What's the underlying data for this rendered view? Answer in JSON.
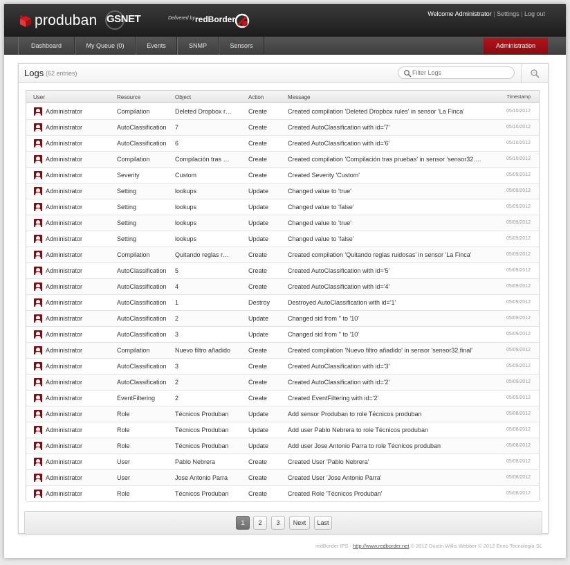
{
  "header": {
    "brand": "produban",
    "partner": "GSNET",
    "delivered_by": "Delivered by",
    "redborder": "redBorder",
    "welcome": "Welcome Administrator",
    "settings": "Settings",
    "logout": "Log out",
    "separator": "|"
  },
  "nav": {
    "items": [
      "Dashboard",
      "My Queue (0)",
      "Events",
      "SNMP",
      "Sensors"
    ],
    "admin": "Administration",
    "admin_color": "#a30f16"
  },
  "panel": {
    "title": "Logs",
    "count": "(62 entries)",
    "filter_placeholder": "Filter Logs"
  },
  "table": {
    "headers": {
      "user": "User",
      "resource": "Resource",
      "object": "Object",
      "action": "Action",
      "message": "Message",
      "timestamp": "Timestamp"
    },
    "rows": [
      {
        "user": "Administrator",
        "resource": "Compilation",
        "object": "Deleted Dropbox r…",
        "action": "Create",
        "message": "Created compilation 'Deleted Dropbox rules' in sensor 'La Finca'",
        "timestamp": "05/10/2012"
      },
      {
        "user": "Administrator",
        "resource": "AutoClassification",
        "object": "7",
        "action": "Create",
        "message": "Created AutoClassification with id='7'",
        "timestamp": "05/10/2012"
      },
      {
        "user": "Administrator",
        "resource": "AutoClassification",
        "object": "6",
        "action": "Create",
        "message": "Created AutoClassification with id='6'",
        "timestamp": "05/10/2012"
      },
      {
        "user": "Administrator",
        "resource": "Compilation",
        "object": "Compilación tras …",
        "action": "Create",
        "message": "Created compilation 'Compilación tras pruebas' in sensor 'sensor32.…",
        "timestamp": "05/10/2012"
      },
      {
        "user": "Administrator",
        "resource": "Severity",
        "object": "Custom",
        "action": "Create",
        "message": "Created Severity 'Custom'",
        "timestamp": "05/09/2012"
      },
      {
        "user": "Administrator",
        "resource": "Setting",
        "object": "lookups",
        "action": "Update",
        "message": "Changed value to 'true'",
        "timestamp": "05/09/2012"
      },
      {
        "user": "Administrator",
        "resource": "Setting",
        "object": "lookups",
        "action": "Update",
        "message": "Changed value to 'false'",
        "timestamp": "05/09/2012"
      },
      {
        "user": "Administrator",
        "resource": "Setting",
        "object": "lookups",
        "action": "Update",
        "message": "Changed value to 'true'",
        "timestamp": "05/09/2012"
      },
      {
        "user": "Administrator",
        "resource": "Setting",
        "object": "lookups",
        "action": "Update",
        "message": "Changed value to 'false'",
        "timestamp": "05/09/2012"
      },
      {
        "user": "Administrator",
        "resource": "Compilation",
        "object": "Quitando reglas r…",
        "action": "Create",
        "message": "Created compilation 'Quitando reglas ruidosas' in sensor 'La Finca'",
        "timestamp": "05/09/2012"
      },
      {
        "user": "Administrator",
        "resource": "AutoClassification",
        "object": "5",
        "action": "Create",
        "message": "Created AutoClassification with id='5'",
        "timestamp": "05/09/2012"
      },
      {
        "user": "Administrator",
        "resource": "AutoClassification",
        "object": "4",
        "action": "Create",
        "message": "Created AutoClassification with id='4'",
        "timestamp": "05/09/2012"
      },
      {
        "user": "Administrator",
        "resource": "AutoClassification",
        "object": "1",
        "action": "Destroy",
        "message": "Destroyed AutoClassification with id='1'",
        "timestamp": "05/09/2012"
      },
      {
        "user": "Administrator",
        "resource": "AutoClassification",
        "object": "2",
        "action": "Update",
        "message": "Changed sid from '' to '10'",
        "timestamp": "05/09/2012"
      },
      {
        "user": "Administrator",
        "resource": "AutoClassification",
        "object": "3",
        "action": "Update",
        "message": "Changed sid from '' to '10'",
        "timestamp": "05/09/2012"
      },
      {
        "user": "Administrator",
        "resource": "Compilation",
        "object": "Nuevo filtro añadido",
        "action": "Create",
        "message": "Created compilation 'Nuevo filtro añadido' in sensor 'sensor32.final'",
        "timestamp": "05/09/2012"
      },
      {
        "user": "Administrator",
        "resource": "AutoClassification",
        "object": "3",
        "action": "Create",
        "message": "Created AutoClassification with id='3'",
        "timestamp": "05/09/2012"
      },
      {
        "user": "Administrator",
        "resource": "AutoClassification",
        "object": "2",
        "action": "Create",
        "message": "Created AutoClassification with id='2'",
        "timestamp": "05/09/2012"
      },
      {
        "user": "Administrator",
        "resource": "EventFiltering",
        "object": "2",
        "action": "Create",
        "message": "Created EventFiltering with id='2'",
        "timestamp": "05/09/2012"
      },
      {
        "user": "Administrator",
        "resource": "Role",
        "object": "Técnicos Produban",
        "action": "Update",
        "message": "Add sensor Produban to role Técnicos produban",
        "timestamp": "05/08/2012"
      },
      {
        "user": "Administrator",
        "resource": "Role",
        "object": "Técnicos Produban",
        "action": "Update",
        "message": "Add user Pablo Nebrera to role Técnicos produban",
        "timestamp": "05/08/2012"
      },
      {
        "user": "Administrator",
        "resource": "Role",
        "object": "Técnicos Produban",
        "action": "Update",
        "message": "Add user Jose Antonio Parra to role Técnicos produban",
        "timestamp": "05/08/2012"
      },
      {
        "user": "Administrator",
        "resource": "User",
        "object": "Pablo Nebrera",
        "action": "Create",
        "message": "Created User 'Pablo Nebrera'",
        "timestamp": "05/08/2012"
      },
      {
        "user": "Administrator",
        "resource": "User",
        "object": "Jose Antonio Parra",
        "action": "Create",
        "message": "Created User 'Jose Antonio Parra'",
        "timestamp": "05/08/2012"
      },
      {
        "user": "Administrator",
        "resource": "Role",
        "object": "Técnicos Produban",
        "action": "Create",
        "message": "Created Role 'Técnicos Produban'",
        "timestamp": "05/08/2012"
      }
    ]
  },
  "pagination": {
    "pages": [
      "1",
      "2",
      "3"
    ],
    "current": "1",
    "next": "Next",
    "last": "Last"
  },
  "footer": {
    "prefix": "redBorder IPS - ",
    "link": "http://www.redborder.net",
    "suffix": " © 2012 Dustin Willis Webber © 2012 Eneo Tecnologia SL"
  }
}
